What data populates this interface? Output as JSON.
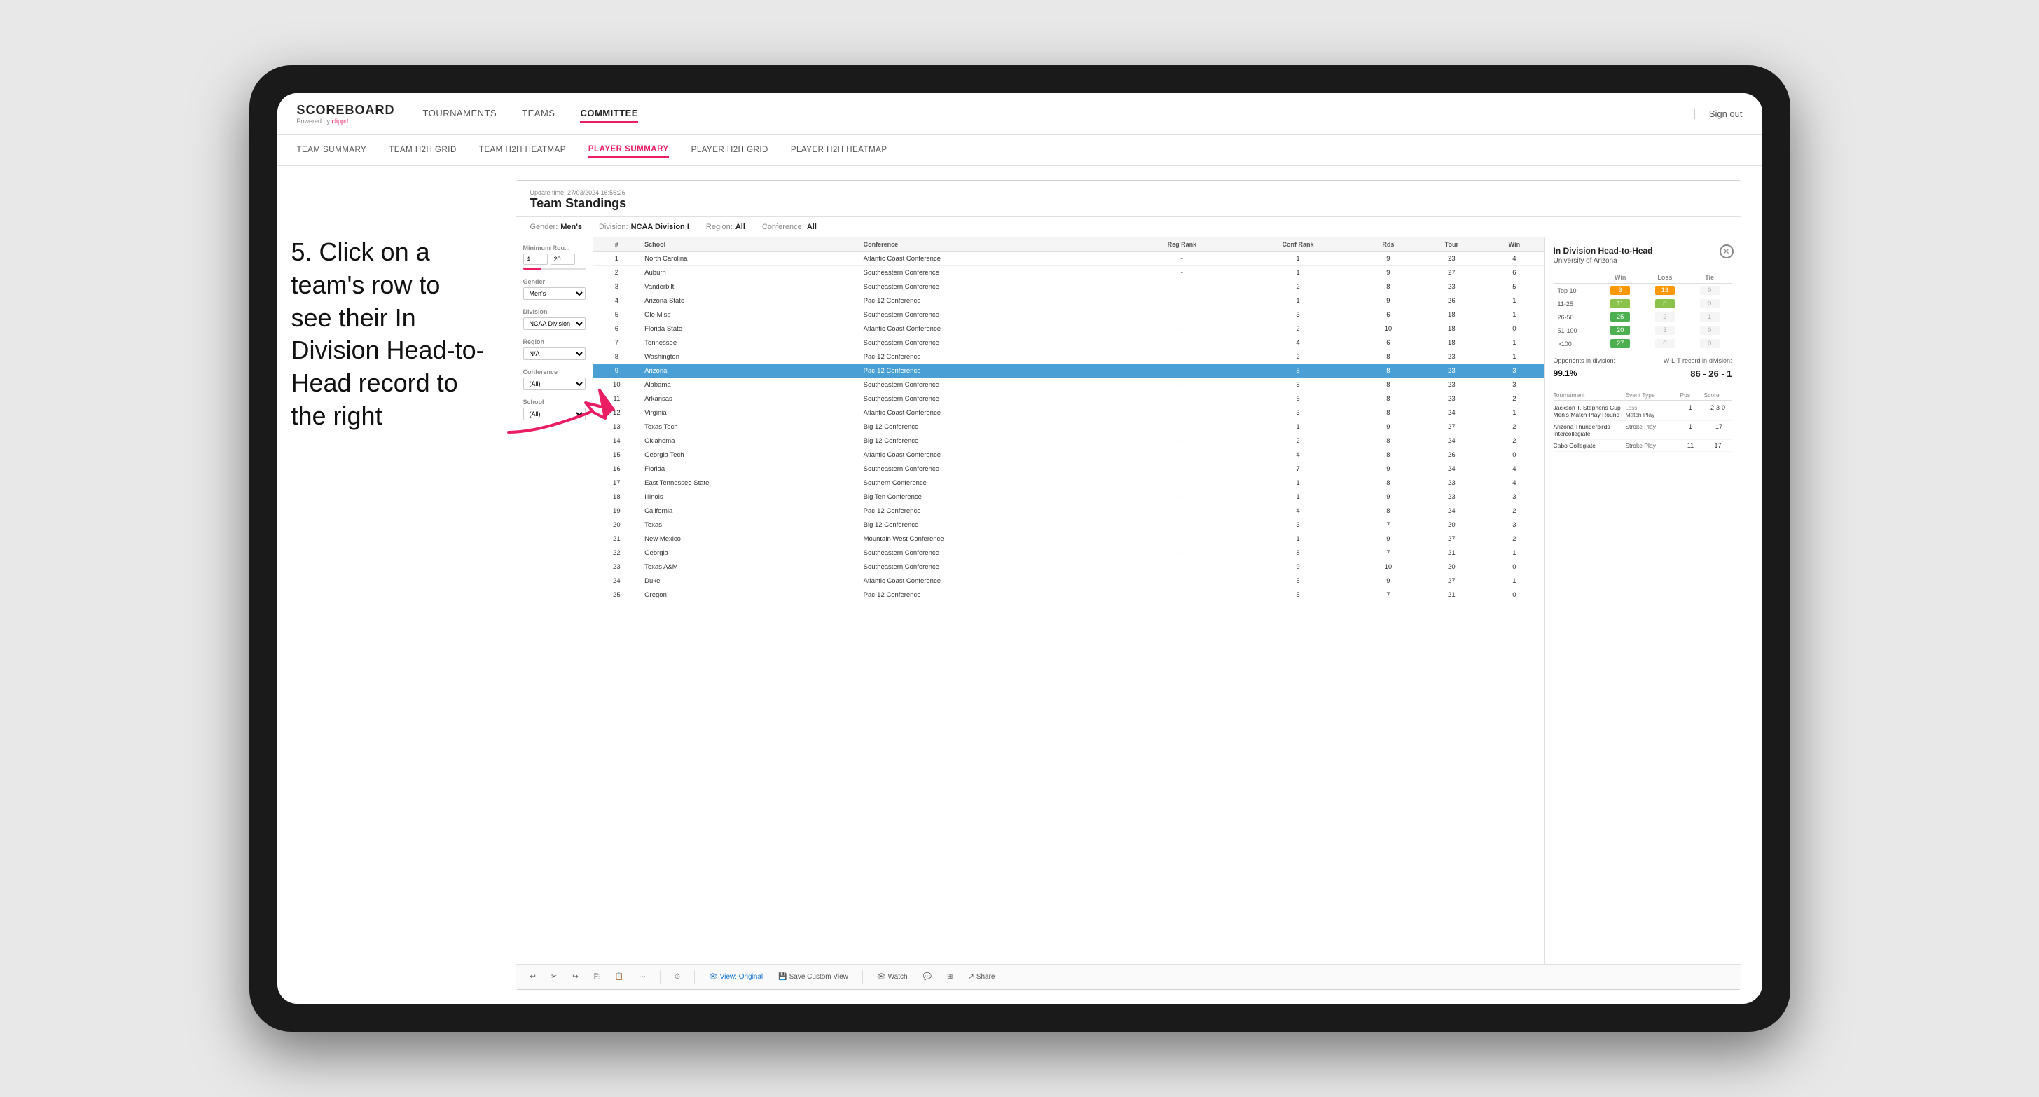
{
  "device": {
    "type": "tablet"
  },
  "annotation": {
    "step": "5.",
    "text": "Click on a team's row to see their In Division Head-to-Head record to the right"
  },
  "top_nav": {
    "logo": "SCOREBOARD",
    "logo_sub": "Powered by clippd",
    "links": [
      "TOURNAMENTS",
      "TEAMS",
      "COMMITTEE"
    ],
    "active_link": "COMMITTEE",
    "sign_out": "Sign out"
  },
  "sub_nav": {
    "links": [
      "TEAM SUMMARY",
      "TEAM H2H GRID",
      "TEAM H2H HEATMAP",
      "PLAYER SUMMARY",
      "PLAYER H2H GRID",
      "PLAYER H2H HEATMAP"
    ],
    "active_link": "PLAYER SUMMARY"
  },
  "sheet": {
    "update_time_label": "Update time:",
    "update_time": "27/03/2024 16:56:26",
    "title": "Team Standings",
    "filters": {
      "gender_label": "Gender:",
      "gender": "Men's",
      "division_label": "Division:",
      "division": "NCAA Division I",
      "region_label": "Region:",
      "region": "All",
      "conference_label": "Conference:",
      "conference": "All"
    },
    "left_filters": {
      "min_rounds_label": "Minimum Rou...",
      "min_rounds_value": "4",
      "min_rounds_max": "20",
      "gender_label": "Gender",
      "gender_options": [
        "Men's"
      ],
      "division_label": "Division",
      "division_options": [
        "NCAA Division I"
      ],
      "region_label": "Region",
      "region_options": [
        "N/A"
      ],
      "conference_label": "Conference",
      "conference_options": [
        "(All)"
      ],
      "school_label": "School",
      "school_options": [
        "(All)"
      ]
    }
  },
  "table": {
    "headers": [
      "#",
      "School",
      "Conference",
      "Reg Rank",
      "Conf Rank",
      "Rds",
      "Tour",
      "Win"
    ],
    "rows": [
      {
        "rank": "1",
        "school": "North Carolina",
        "conference": "Atlantic Coast Conference",
        "reg_rank": "-",
        "conf_rank": "1",
        "rds": "9",
        "tour": "23",
        "win": "4"
      },
      {
        "rank": "2",
        "school": "Auburn",
        "conference": "Southeastern Conference",
        "reg_rank": "-",
        "conf_rank": "1",
        "rds": "9",
        "tour": "27",
        "win": "6"
      },
      {
        "rank": "3",
        "school": "Vanderbilt",
        "conference": "Southeastern Conference",
        "reg_rank": "-",
        "conf_rank": "2",
        "rds": "8",
        "tour": "23",
        "win": "5"
      },
      {
        "rank": "4",
        "school": "Arizona State",
        "conference": "Pac-12 Conference",
        "reg_rank": "-",
        "conf_rank": "1",
        "rds": "9",
        "tour": "26",
        "win": "1"
      },
      {
        "rank": "5",
        "school": "Ole Miss",
        "conference": "Southeastern Conference",
        "reg_rank": "-",
        "conf_rank": "3",
        "rds": "6",
        "tour": "18",
        "win": "1"
      },
      {
        "rank": "6",
        "school": "Florida State",
        "conference": "Atlantic Coast Conference",
        "reg_rank": "-",
        "conf_rank": "2",
        "rds": "10",
        "tour": "18",
        "win": "0"
      },
      {
        "rank": "7",
        "school": "Tennessee",
        "conference": "Southeastern Conference",
        "reg_rank": "-",
        "conf_rank": "4",
        "rds": "6",
        "tour": "18",
        "win": "1"
      },
      {
        "rank": "8",
        "school": "Washington",
        "conference": "Pac-12 Conference",
        "reg_rank": "-",
        "conf_rank": "2",
        "rds": "8",
        "tour": "23",
        "win": "1"
      },
      {
        "rank": "9",
        "school": "Arizona",
        "conference": "Pac-12 Conference",
        "reg_rank": "-",
        "conf_rank": "5",
        "rds": "8",
        "tour": "23",
        "win": "3",
        "selected": true
      },
      {
        "rank": "10",
        "school": "Alabama",
        "conference": "Southeastern Conference",
        "reg_rank": "-",
        "conf_rank": "5",
        "rds": "8",
        "tour": "23",
        "win": "3"
      },
      {
        "rank": "11",
        "school": "Arkansas",
        "conference": "Southeastern Conference",
        "reg_rank": "-",
        "conf_rank": "6",
        "rds": "8",
        "tour": "23",
        "win": "2"
      },
      {
        "rank": "12",
        "school": "Virginia",
        "conference": "Atlantic Coast Conference",
        "reg_rank": "-",
        "conf_rank": "3",
        "rds": "8",
        "tour": "24",
        "win": "1"
      },
      {
        "rank": "13",
        "school": "Texas Tech",
        "conference": "Big 12 Conference",
        "reg_rank": "-",
        "conf_rank": "1",
        "rds": "9",
        "tour": "27",
        "win": "2"
      },
      {
        "rank": "14",
        "school": "Oklahoma",
        "conference": "Big 12 Conference",
        "reg_rank": "-",
        "conf_rank": "2",
        "rds": "8",
        "tour": "24",
        "win": "2"
      },
      {
        "rank": "15",
        "school": "Georgia Tech",
        "conference": "Atlantic Coast Conference",
        "reg_rank": "-",
        "conf_rank": "4",
        "rds": "8",
        "tour": "26",
        "win": "0"
      },
      {
        "rank": "16",
        "school": "Florida",
        "conference": "Southeastern Conference",
        "reg_rank": "-",
        "conf_rank": "7",
        "rds": "9",
        "tour": "24",
        "win": "4"
      },
      {
        "rank": "17",
        "school": "East Tennessee State",
        "conference": "Southern Conference",
        "reg_rank": "-",
        "conf_rank": "1",
        "rds": "8",
        "tour": "23",
        "win": "4"
      },
      {
        "rank": "18",
        "school": "Illinois",
        "conference": "Big Ten Conference",
        "reg_rank": "-",
        "conf_rank": "1",
        "rds": "9",
        "tour": "23",
        "win": "3"
      },
      {
        "rank": "19",
        "school": "California",
        "conference": "Pac-12 Conference",
        "reg_rank": "-",
        "conf_rank": "4",
        "rds": "8",
        "tour": "24",
        "win": "2"
      },
      {
        "rank": "20",
        "school": "Texas",
        "conference": "Big 12 Conference",
        "reg_rank": "-",
        "conf_rank": "3",
        "rds": "7",
        "tour": "20",
        "win": "3"
      },
      {
        "rank": "21",
        "school": "New Mexico",
        "conference": "Mountain West Conference",
        "reg_rank": "-",
        "conf_rank": "1",
        "rds": "9",
        "tour": "27",
        "win": "2"
      },
      {
        "rank": "22",
        "school": "Georgia",
        "conference": "Southeastern Conference",
        "reg_rank": "-",
        "conf_rank": "8",
        "rds": "7",
        "tour": "21",
        "win": "1"
      },
      {
        "rank": "23",
        "school": "Texas A&M",
        "conference": "Southeastern Conference",
        "reg_rank": "-",
        "conf_rank": "9",
        "rds": "10",
        "tour": "20",
        "win": "0"
      },
      {
        "rank": "24",
        "school": "Duke",
        "conference": "Atlantic Coast Conference",
        "reg_rank": "-",
        "conf_rank": "5",
        "rds": "9",
        "tour": "27",
        "win": "1"
      },
      {
        "rank": "25",
        "school": "Oregon",
        "conference": "Pac-12 Conference",
        "reg_rank": "-",
        "conf_rank": "5",
        "rds": "7",
        "tour": "21",
        "win": "0"
      }
    ]
  },
  "h2h_panel": {
    "title": "In Division Head-to-Head",
    "school": "University of Arizona",
    "win_label": "Win",
    "loss_label": "Loss",
    "tie_label": "Tie",
    "rows": [
      {
        "label": "Top 10",
        "win": "3",
        "loss": "13",
        "tie": "0",
        "win_class": "cell-orange",
        "loss_class": "cell-orange"
      },
      {
        "label": "11-25",
        "win": "11",
        "loss": "8",
        "tie": "0",
        "win_class": "cell-light-green",
        "loss_class": "cell-light-green"
      },
      {
        "label": "26-50",
        "win": "25",
        "loss": "2",
        "tie": "1",
        "win_class": "cell-green",
        "loss_class": "cell-zero"
      },
      {
        "label": "51-100",
        "win": "20",
        "loss": "3",
        "tie": "0",
        "win_class": "cell-green",
        "loss_class": "cell-zero"
      },
      {
        "label": ">100",
        "win": "27",
        "loss": "0",
        "tie": "0",
        "win_class": "cell-green",
        "loss_class": "cell-zero"
      }
    ],
    "opponents_label": "Opponents in division:",
    "opponents_value": "99.1%",
    "wlt_label": "W-L-T record in-division:",
    "wlt_value": "86 - 26 - 1",
    "tournament_label": "Tournament",
    "event_type_label": "Event Type",
    "pos_label": "Pos",
    "score_label": "Score",
    "tournaments": [
      {
        "name": "Jackson T. Stephens Cup Men's Match-Play Round",
        "type": "Match Play",
        "result": "Loss",
        "score": "2-3-0",
        "pos": "1"
      },
      {
        "name": "Arizona Thunderbirds Intercollegiate",
        "type": "Stroke Play",
        "pos": "1",
        "score": "-17"
      },
      {
        "name": "Cabo Collegiate",
        "type": "Stroke Play",
        "pos": "11",
        "score": "17"
      }
    ]
  },
  "toolbar": {
    "buttons": [
      "undo",
      "cut",
      "redo",
      "copy",
      "paste",
      "more",
      "clock",
      "view_original",
      "save_custom_view",
      "watch",
      "comment",
      "share"
    ],
    "view_original": "View: Original",
    "save_custom_view": "Save Custom View",
    "watch": "Watch",
    "share": "Share"
  }
}
